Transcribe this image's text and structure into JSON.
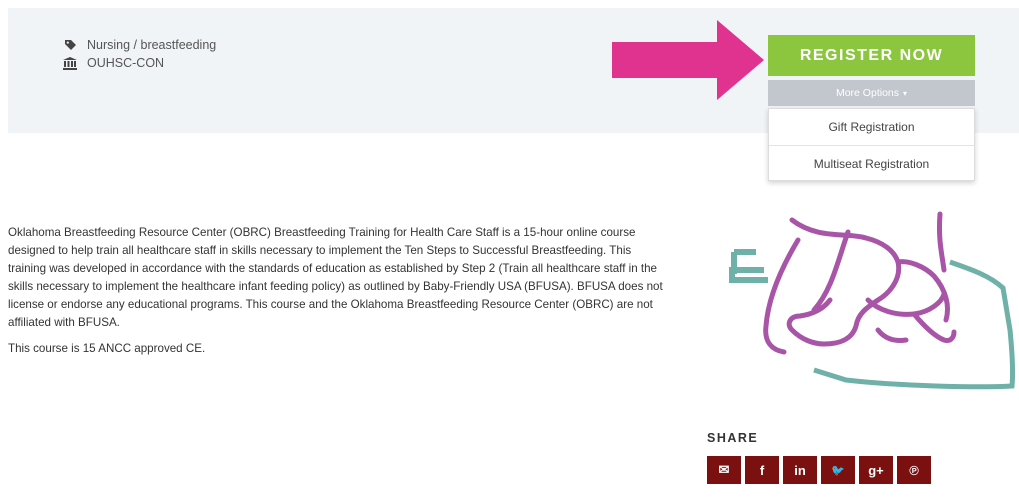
{
  "meta": {
    "category_icon": "tag-icon",
    "category": "Nursing / breastfeeding",
    "org_icon": "institution-icon",
    "organization": "OUHSC-CON"
  },
  "register": {
    "button_label": "REGISTER NOW",
    "more_options_label": "More Options",
    "options": [
      "Gift Registration",
      "Multiseat Registration"
    ]
  },
  "description": {
    "paragraph1": "Oklahoma Breastfeeding Resource Center (OBRC) Breastfeeding Training for Health Care Staff is a 15-hour online course designed to help train all healthcare staff in skills necessary to implement the Ten Steps to Successful Breastfeeding. This training was developed in accordance with the standards of education as established by Step 2 (Train all healthcare staff in the skills necessary to implement the healthcare infant feeding policy) as outlined by Baby-Friendly USA (BFUSA). BFUSA does not license or endorse any educational programs. This course and the Oklahoma Breastfeeding Resource Center (OBRC) are not affiliated with BFUSA.",
    "paragraph2": "This course is 15 ANCC approved CE."
  },
  "share": {
    "title": "SHARE",
    "buttons": [
      {
        "icon": "email-icon",
        "glyph": "✉"
      },
      {
        "icon": "facebook-icon",
        "glyph": "f"
      },
      {
        "icon": "linkedin-icon",
        "glyph": "in"
      },
      {
        "icon": "twitter-icon",
        "glyph": "🐦"
      },
      {
        "icon": "google-plus-icon",
        "glyph": "g+"
      },
      {
        "icon": "pinterest-icon",
        "glyph": "℗"
      }
    ]
  },
  "colors": {
    "register": "#8cc63f",
    "more_options": "#c2c7cd",
    "arrow": "#e0338f",
    "share_button": "#7a1010",
    "logo_purple": "#a855a8",
    "logo_teal": "#6fb0a8"
  }
}
